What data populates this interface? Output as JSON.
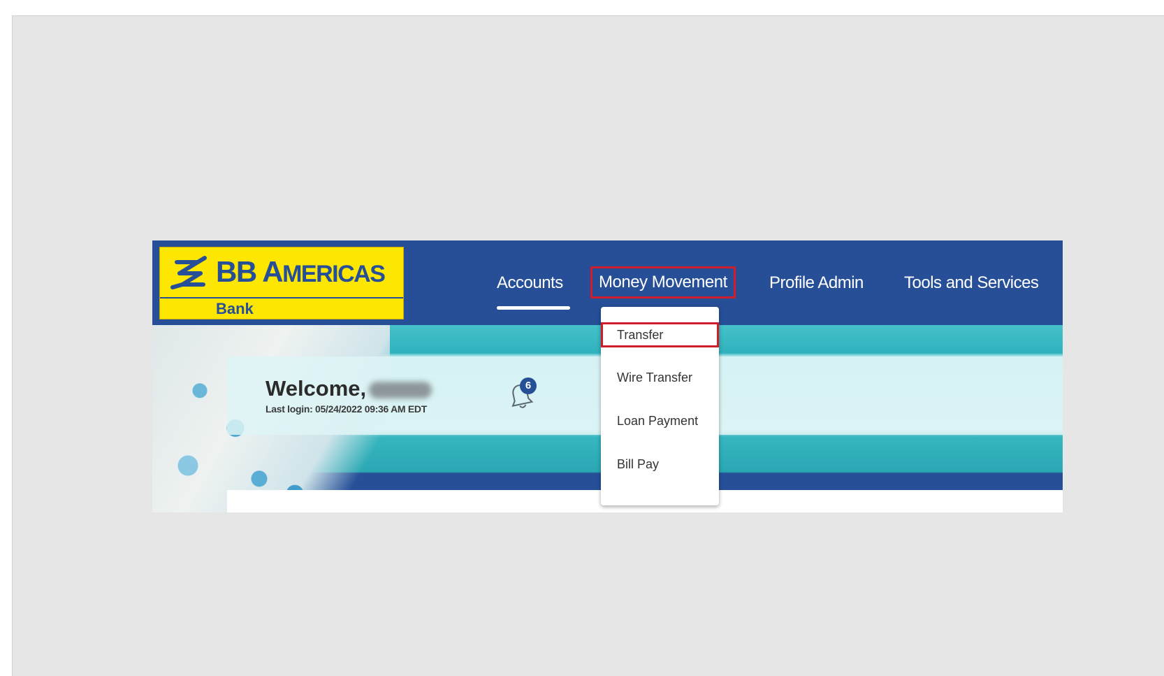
{
  "logo": {
    "title_main": "BB A",
    "title_smallcaps": "MERICAS",
    "subtitle": "Bank",
    "mark_icon": "bb-logo-icon"
  },
  "nav": {
    "items": [
      {
        "label": "Accounts",
        "active": true
      },
      {
        "label": "Money Movement",
        "highlighted": true
      },
      {
        "label": "Profile Admin"
      },
      {
        "label": "Tools and Services"
      }
    ]
  },
  "welcome": {
    "title": "Welcome,",
    "last_login": "Last login: 05/24/2022 09:36 AM EDT",
    "notifications_count": "6",
    "bell_icon": "bell-icon"
  },
  "dropdown": {
    "items": [
      {
        "label": "Transfer",
        "highlighted": true
      },
      {
        "label": "Wire Transfer"
      },
      {
        "label": "Loan Payment"
      },
      {
        "label": "Bill Pay"
      }
    ]
  },
  "colors": {
    "header": "#264f97",
    "logo_bg": "#fde700",
    "highlight": "#d01d2b",
    "canvas": "#e6e6e6"
  }
}
